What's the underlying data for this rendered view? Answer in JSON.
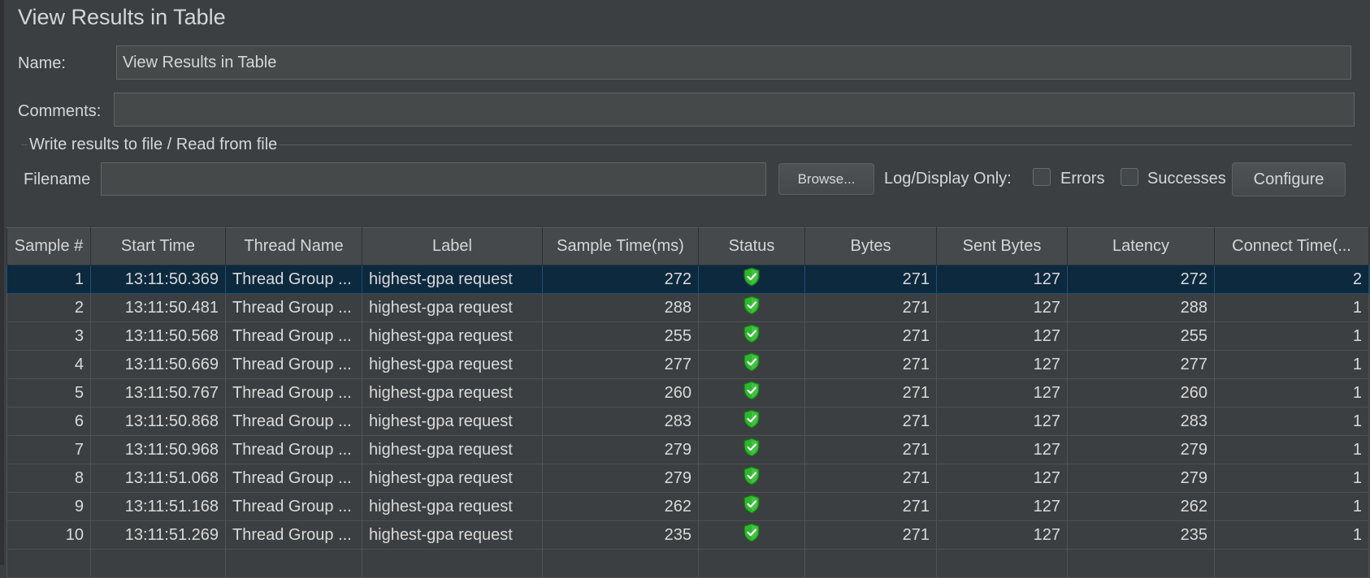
{
  "panel": {
    "title": "View Results in Table",
    "name_label": "Name:",
    "name_value": "View Results in Table",
    "comments_label": "Comments:",
    "comments_value": ""
  },
  "file_group": {
    "title": "Write results to file / Read from file",
    "filename_label": "Filename",
    "filename_value": "",
    "browse_label": "Browse...",
    "log_label": "Log/Display Only:",
    "errors_label": "Errors",
    "errors_checked": false,
    "successes_label": "Successes",
    "successes_checked": false,
    "configure_label": "Configure"
  },
  "table": {
    "columns": [
      "Sample #",
      "Start Time",
      "Thread Name",
      "Label",
      "Sample Time(ms)",
      "Status",
      "Bytes",
      "Sent Bytes",
      "Latency",
      "Connect Time(..."
    ],
    "selected_row": 0,
    "status_icon": "success-shield-icon",
    "status_color": "#2fb52f",
    "rows": [
      {
        "sample": "1",
        "start": "13:11:50.369",
        "thread": "Thread Group ...",
        "label": "highest-gpa request",
        "time": "272",
        "bytes": "271",
        "sent": "127",
        "latency": "272",
        "connect": "2"
      },
      {
        "sample": "2",
        "start": "13:11:50.481",
        "thread": "Thread Group ...",
        "label": "highest-gpa request",
        "time": "288",
        "bytes": "271",
        "sent": "127",
        "latency": "288",
        "connect": "1"
      },
      {
        "sample": "3",
        "start": "13:11:50.568",
        "thread": "Thread Group ...",
        "label": "highest-gpa request",
        "time": "255",
        "bytes": "271",
        "sent": "127",
        "latency": "255",
        "connect": "1"
      },
      {
        "sample": "4",
        "start": "13:11:50.669",
        "thread": "Thread Group ...",
        "label": "highest-gpa request",
        "time": "277",
        "bytes": "271",
        "sent": "127",
        "latency": "277",
        "connect": "1"
      },
      {
        "sample": "5",
        "start": "13:11:50.767",
        "thread": "Thread Group ...",
        "label": "highest-gpa request",
        "time": "260",
        "bytes": "271",
        "sent": "127",
        "latency": "260",
        "connect": "1"
      },
      {
        "sample": "6",
        "start": "13:11:50.868",
        "thread": "Thread Group ...",
        "label": "highest-gpa request",
        "time": "283",
        "bytes": "271",
        "sent": "127",
        "latency": "283",
        "connect": "1"
      },
      {
        "sample": "7",
        "start": "13:11:50.968",
        "thread": "Thread Group ...",
        "label": "highest-gpa request",
        "time": "279",
        "bytes": "271",
        "sent": "127",
        "latency": "279",
        "connect": "1"
      },
      {
        "sample": "8",
        "start": "13:11:51.068",
        "thread": "Thread Group ...",
        "label": "highest-gpa request",
        "time": "279",
        "bytes": "271",
        "sent": "127",
        "latency": "279",
        "connect": "1"
      },
      {
        "sample": "9",
        "start": "13:11:51.168",
        "thread": "Thread Group ...",
        "label": "highest-gpa request",
        "time": "262",
        "bytes": "271",
        "sent": "127",
        "latency": "262",
        "connect": "1"
      },
      {
        "sample": "10",
        "start": "13:11:51.269",
        "thread": "Thread Group ...",
        "label": "highest-gpa request",
        "time": "235",
        "bytes": "271",
        "sent": "127",
        "latency": "235",
        "connect": "1"
      }
    ]
  }
}
